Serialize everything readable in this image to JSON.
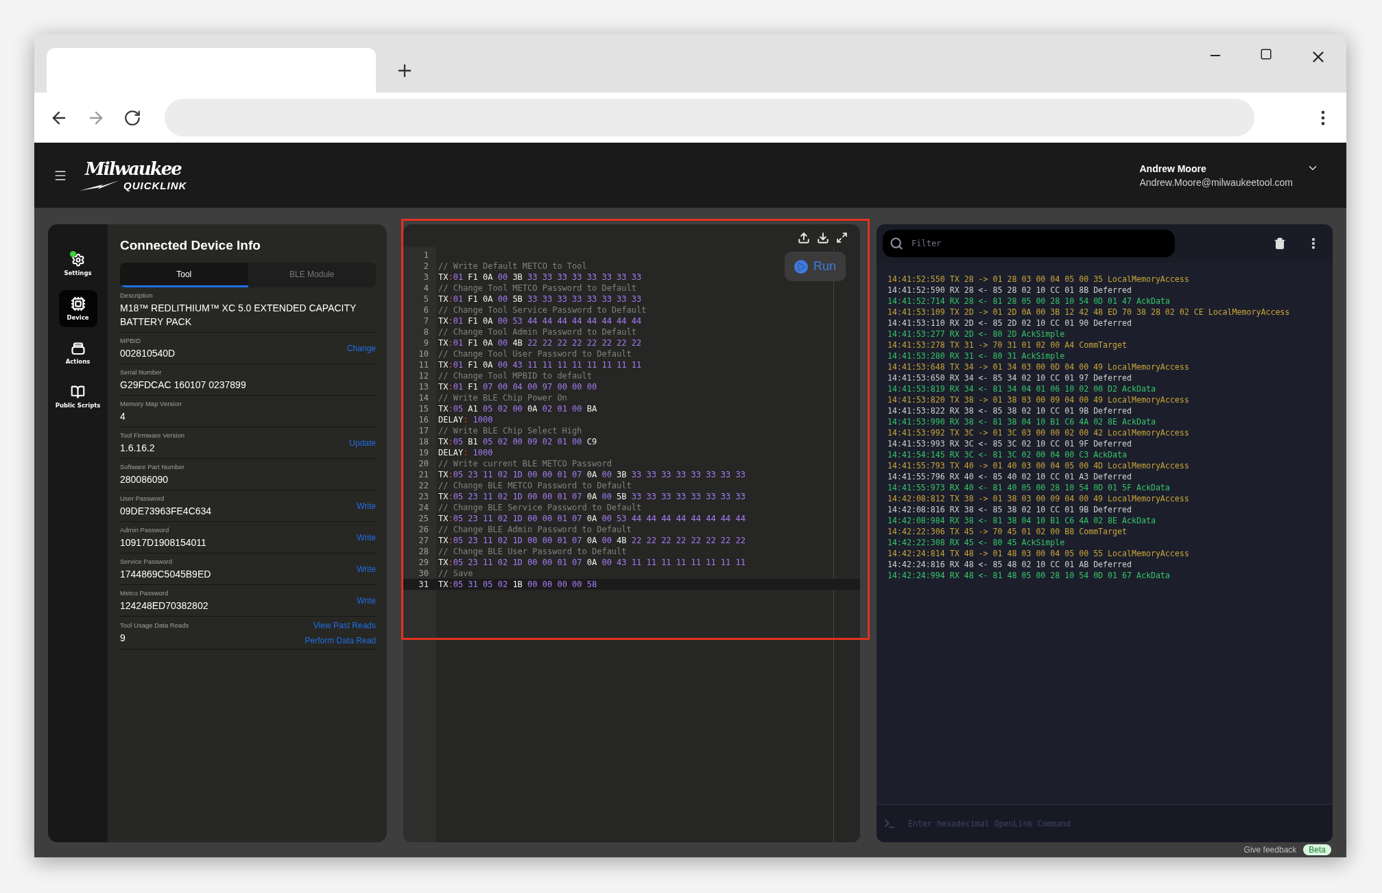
{
  "app_header": {
    "brand": "Milwaukee",
    "product": "QUICKLINK",
    "user_name": "Andrew Moore",
    "user_email": "Andrew.Moore@milwaukeetool.com"
  },
  "nav": [
    {
      "kind": "settings",
      "label": "Settings",
      "selected": false,
      "status_dot": true
    },
    {
      "kind": "device",
      "label": "Device",
      "selected": true,
      "status_dot": false
    },
    {
      "kind": "actions",
      "label": "Actions",
      "selected": false,
      "status_dot": false
    },
    {
      "kind": "scripts",
      "label": "Public Scripts",
      "selected": false,
      "status_dot": false
    }
  ],
  "device_info": {
    "title": "Connected Device Info",
    "tabs": [
      {
        "label": "Tool",
        "selected": true
      },
      {
        "label": "BLE Module",
        "selected": false
      }
    ],
    "fields": [
      {
        "label": "Description",
        "value": "M18™ REDLITHIUM™ XC 5.0 EXTENDED CAPACITY BATTERY PACK"
      },
      {
        "label": "MPBID",
        "value": "002810540D",
        "actions": [
          "Change"
        ]
      },
      {
        "label": "Serial Number",
        "value": "G29FDCAC 160107 0237899"
      },
      {
        "label": "Memory Map Version",
        "value": "4"
      },
      {
        "label": "Tool Firmware Version",
        "value": "1.6.16.2",
        "actions": [
          "Update"
        ]
      },
      {
        "label": "Software Part Number",
        "value": "280086090"
      },
      {
        "label": "User Password",
        "value": "09DE73963FE4C634",
        "actions": [
          "Write"
        ]
      },
      {
        "label": "Admin Password",
        "value": "10917D1908154011",
        "actions": [
          "Write"
        ]
      },
      {
        "label": "Service Password",
        "value": "1744869C5045B9ED",
        "actions": [
          "Write"
        ]
      },
      {
        "label": "Metco Password",
        "value": "124248ED70382802",
        "actions": [
          "Write"
        ]
      },
      {
        "label": "Tool Usage Data Reads",
        "value": "9",
        "actions": [
          "View Past Reads",
          "Perform Data Read"
        ]
      }
    ]
  },
  "editor": {
    "highlighted": true,
    "run_label": "Run",
    "lines": [
      {
        "n": "1",
        "active": false
      },
      {
        "n": "2",
        "active": false,
        "segments": [
          {
            "kind": "comment",
            "text": "// Write Default METCO to Tool"
          }
        ]
      },
      {
        "n": "3",
        "active": false,
        "segments": [
          {
            "kind": "plain",
            "text": "TX"
          },
          {
            "kind": "punct",
            "text": ":"
          },
          {
            "kind": "num",
            "text": "01"
          },
          {
            "kind": "plain",
            "text": " F1 0A "
          },
          {
            "kind": "num",
            "text": "00"
          },
          {
            "kind": "plain",
            "text": " 3B "
          },
          {
            "kind": "num",
            "text": "33 33 33 33 33 33 33 33"
          }
        ]
      },
      {
        "n": "4",
        "active": false,
        "segments": [
          {
            "kind": "comment",
            "text": "// Change Tool METCO Password to Default"
          }
        ]
      },
      {
        "n": "5",
        "active": false,
        "segments": [
          {
            "kind": "plain",
            "text": "TX"
          },
          {
            "kind": "punct",
            "text": ":"
          },
          {
            "kind": "num",
            "text": "01"
          },
          {
            "kind": "plain",
            "text": " F1 0A "
          },
          {
            "kind": "num",
            "text": "00"
          },
          {
            "kind": "plain",
            "text": " 5B "
          },
          {
            "kind": "num",
            "text": "33 33 33 33 33 33 33 33"
          }
        ]
      },
      {
        "n": "6",
        "active": false,
        "segments": [
          {
            "kind": "comment",
            "text": "// Change Tool Service Password to Default"
          }
        ]
      },
      {
        "n": "7",
        "active": false,
        "segments": [
          {
            "kind": "plain",
            "text": "TX"
          },
          {
            "kind": "punct",
            "text": ":"
          },
          {
            "kind": "num",
            "text": "01"
          },
          {
            "kind": "plain",
            "text": " F1 0A "
          },
          {
            "kind": "num",
            "text": "00 53 44 44 44 44 44 44 44 44"
          }
        ]
      },
      {
        "n": "8",
        "active": false,
        "segments": [
          {
            "kind": "comment",
            "text": "// Change Tool Admin Password to Default"
          }
        ]
      },
      {
        "n": "9",
        "active": false,
        "segments": [
          {
            "kind": "plain",
            "text": "TX"
          },
          {
            "kind": "punct",
            "text": ":"
          },
          {
            "kind": "num",
            "text": "01"
          },
          {
            "kind": "plain",
            "text": " F1 0A "
          },
          {
            "kind": "num",
            "text": "00"
          },
          {
            "kind": "plain",
            "text": " 4B "
          },
          {
            "kind": "num",
            "text": "22 22 22 22 22 22 22 22"
          }
        ]
      },
      {
        "n": "10",
        "active": false,
        "segments": [
          {
            "kind": "comment",
            "text": "// Change Tool User Password to Default"
          }
        ]
      },
      {
        "n": "11",
        "active": false,
        "segments": [
          {
            "kind": "plain",
            "text": "TX"
          },
          {
            "kind": "punct",
            "text": ":"
          },
          {
            "kind": "num",
            "text": "01"
          },
          {
            "kind": "plain",
            "text": " F1 0A "
          },
          {
            "kind": "num",
            "text": "00 43 11 11 11 11 11 11 11 11"
          }
        ]
      },
      {
        "n": "12",
        "active": false,
        "segments": [
          {
            "kind": "comment",
            "text": "// Change Tool MPBID to default"
          }
        ]
      },
      {
        "n": "13",
        "active": false,
        "segments": [
          {
            "kind": "plain",
            "text": "TX"
          },
          {
            "kind": "punct",
            "text": ":"
          },
          {
            "kind": "num",
            "text": "01"
          },
          {
            "kind": "plain",
            "text": " F1 "
          },
          {
            "kind": "num",
            "text": "07 00 04 00 97 00 00 00"
          }
        ]
      },
      {
        "n": "14",
        "active": false,
        "segments": [
          {
            "kind": "comment",
            "text": "// Write BLE Chip Power On"
          }
        ]
      },
      {
        "n": "15",
        "active": false,
        "segments": [
          {
            "kind": "plain",
            "text": "TX"
          },
          {
            "kind": "punct",
            "text": ":"
          },
          {
            "kind": "num",
            "text": "05"
          },
          {
            "kind": "plain",
            "text": " A1 "
          },
          {
            "kind": "num",
            "text": "05 02 00"
          },
          {
            "kind": "plain",
            "text": " 0A "
          },
          {
            "kind": "num",
            "text": "02 01 00"
          },
          {
            "kind": "plain",
            "text": " BA"
          }
        ]
      },
      {
        "n": "16",
        "active": false,
        "segments": [
          {
            "kind": "plain",
            "text": "DELAY"
          },
          {
            "kind": "punct",
            "text": ":"
          },
          {
            "kind": "num",
            "text": " 1000"
          }
        ]
      },
      {
        "n": "17",
        "active": false,
        "segments": [
          {
            "kind": "comment",
            "text": "// Write BLE Chip Select High"
          }
        ]
      },
      {
        "n": "18",
        "active": false,
        "segments": [
          {
            "kind": "plain",
            "text": "TX"
          },
          {
            "kind": "punct",
            "text": ":"
          },
          {
            "kind": "num",
            "text": "05"
          },
          {
            "kind": "plain",
            "text": " B1 "
          },
          {
            "kind": "num",
            "text": "05 02 00 09 02 01 00"
          },
          {
            "kind": "plain",
            "text": " C9"
          }
        ]
      },
      {
        "n": "19",
        "active": false,
        "segments": [
          {
            "kind": "plain",
            "text": "DELAY"
          },
          {
            "kind": "punct",
            "text": ":"
          },
          {
            "kind": "num",
            "text": " 1000"
          }
        ]
      },
      {
        "n": "20",
        "active": false,
        "segments": [
          {
            "kind": "comment",
            "text": "// Write current BLE METCO Password"
          }
        ]
      },
      {
        "n": "21",
        "active": false,
        "segments": [
          {
            "kind": "plain",
            "text": "TX"
          },
          {
            "kind": "punct",
            "text": ":"
          },
          {
            "kind": "num",
            "text": "05 23 11 02 1D 00 00 01 07"
          },
          {
            "kind": "plain",
            "text": " 0A "
          },
          {
            "kind": "num",
            "text": "00"
          },
          {
            "kind": "plain",
            "text": " 3B "
          },
          {
            "kind": "num",
            "text": "33 33 33 33 33 33 33 33"
          }
        ]
      },
      {
        "n": "22",
        "active": false,
        "segments": [
          {
            "kind": "comment",
            "text": "// Change BLE METCO Password to Default"
          }
        ]
      },
      {
        "n": "23",
        "active": false,
        "segments": [
          {
            "kind": "plain",
            "text": "TX"
          },
          {
            "kind": "punct",
            "text": ":"
          },
          {
            "kind": "num",
            "text": "05 23 11 02 1D 00 00 01 07"
          },
          {
            "kind": "plain",
            "text": " 0A "
          },
          {
            "kind": "num",
            "text": "00"
          },
          {
            "kind": "plain",
            "text": " 5B "
          },
          {
            "kind": "num",
            "text": "33 33 33 33 33 33 33 33"
          }
        ]
      },
      {
        "n": "24",
        "active": false,
        "segments": [
          {
            "kind": "comment",
            "text": "// Change BLE Service Password to Default"
          }
        ]
      },
      {
        "n": "25",
        "active": false,
        "segments": [
          {
            "kind": "plain",
            "text": "TX"
          },
          {
            "kind": "punct",
            "text": ":"
          },
          {
            "kind": "num",
            "text": "05 23 11 02 1D 00 00 01 07"
          },
          {
            "kind": "plain",
            "text": " 0A "
          },
          {
            "kind": "num",
            "text": "00 53 44 44 44 44 44 44 44 44"
          }
        ]
      },
      {
        "n": "26",
        "active": false,
        "segments": [
          {
            "kind": "comment",
            "text": "// Change BLE Admin Password to Default"
          }
        ]
      },
      {
        "n": "27",
        "active": false,
        "segments": [
          {
            "kind": "plain",
            "text": "TX"
          },
          {
            "kind": "punct",
            "text": ":"
          },
          {
            "kind": "num",
            "text": "05 23 11 02 1D 00 00 01 07"
          },
          {
            "kind": "plain",
            "text": " 0A "
          },
          {
            "kind": "num",
            "text": "00"
          },
          {
            "kind": "plain",
            "text": " 4B "
          },
          {
            "kind": "num",
            "text": "22 22 22 22 22 22 22 22"
          }
        ]
      },
      {
        "n": "28",
        "active": false,
        "segments": [
          {
            "kind": "comment",
            "text": "// Change BLE User Password to Default"
          }
        ]
      },
      {
        "n": "29",
        "active": false,
        "segments": [
          {
            "kind": "plain",
            "text": "TX"
          },
          {
            "kind": "punct",
            "text": ":"
          },
          {
            "kind": "num",
            "text": "05 23 11 02 1D 00 00 01 07"
          },
          {
            "kind": "plain",
            "text": " 0A "
          },
          {
            "kind": "num",
            "text": "00 43 11 11 11 11 11 11 11 11"
          }
        ]
      },
      {
        "n": "30",
        "active": false,
        "segments": [
          {
            "kind": "comment",
            "text": "// Save"
          }
        ]
      },
      {
        "n": "31",
        "active": true,
        "segments": [
          {
            "kind": "plain",
            "text": "TX"
          },
          {
            "kind": "punct",
            "text": ":"
          },
          {
            "kind": "num",
            "text": "05 31 05 02"
          },
          {
            "kind": "plain",
            "text": " 1B "
          },
          {
            "kind": "num",
            "text": "00 00 00 00 58"
          }
        ]
      }
    ]
  },
  "console": {
    "filter_placeholder": "Filter",
    "command_placeholder": "Enter hexadecimal OpenLink Command",
    "entries": [
      {
        "text": "14:41:52:550 TX 28 -> 01 28 03 00 04 05 00 35 LocalMemoryAccess",
        "color": "#c9a43a"
      },
      {
        "text": "14:41:52:590 RX 28 <- 85 28 02 10 CC 01 8B Deferred",
        "color": "#d0d0d0"
      },
      {
        "text": "14:41:52:714 RX 28 <- 81 28 05 00 28 10 54 0D 01 47 AckData",
        "color": "#35c46a"
      },
      {
        "text": "14:41:53:109 TX 2D -> 01 2D 0A 00 3B 12 42 48 ED 70 38 28 02 02 CE LocalMemoryAccess",
        "color": "#c9a43a"
      },
      {
        "text": "14:41:53:110 RX 2D <- 85 2D 02 10 CC 01 90 Deferred",
        "color": "#d0d0d0"
      },
      {
        "text": "14:41:53:277 RX 2D <- 80 2D AckSimple",
        "color": "#35c46a"
      },
      {
        "text": "14:41:53:278 TX 31 -> 70 31 01 02 00 A4 CommTarget",
        "color": "#c9a43a"
      },
      {
        "text": "14:41:53:280 RX 31 <- 80 31 AckSimple",
        "color": "#35c46a"
      },
      {
        "text": "14:41:53:648 TX 34 -> 01 34 03 00 0D 04 00 49 LocalMemoryAccess",
        "color": "#c9a43a"
      },
      {
        "text": "14:41:53:650 RX 34 <- 85 34 02 10 CC 01 97 Deferred",
        "color": "#d0d0d0"
      },
      {
        "text": "14:41:53:819 RX 34 <- 81 34 04 01 06 10 02 00 D2 AckData",
        "color": "#35c46a"
      },
      {
        "text": "14:41:53:820 TX 38 -> 01 38 03 00 09 04 00 49 LocalMemoryAccess",
        "color": "#c9a43a"
      },
      {
        "text": "14:41:53:822 RX 38 <- 85 38 02 10 CC 01 9B Deferred",
        "color": "#d0d0d0"
      },
      {
        "text": "14:41:53:990 RX 38 <- 81 38 04 10 B1 C6 4A 02 8E AckData",
        "color": "#35c46a"
      },
      {
        "text": "14:41:53:992 TX 3C -> 01 3C 03 00 00 02 00 42 LocalMemoryAccess",
        "color": "#c9a43a"
      },
      {
        "text": "14:41:53:993 RX 3C <- 85 3C 02 10 CC 01 9F Deferred",
        "color": "#d0d0d0"
      },
      {
        "text": "14:41:54:145 RX 3C <- 81 3C 02 00 04 00 C3 AckData",
        "color": "#35c46a"
      },
      {
        "text": "14:41:55:793 TX 40 -> 01 40 03 00 04 05 00 4D LocalMemoryAccess",
        "color": "#c9a43a"
      },
      {
        "text": "14:41:55:796 RX 40 <- 85 40 02 10 CC 01 A3 Deferred",
        "color": "#d0d0d0"
      },
      {
        "text": "14:41:55:973 RX 40 <- 81 40 05 00 28 10 54 0D 01 5F AckData",
        "color": "#35c46a"
      },
      {
        "text": "14:42:08:812 TX 38 -> 01 38 03 00 09 04 00 49 LocalMemoryAccess",
        "color": "#c9a43a"
      },
      {
        "text": "14:42:08:816 RX 38 <- 85 38 02 10 CC 01 9B Deferred",
        "color": "#d0d0d0"
      },
      {
        "text": "14:42:08:984 RX 38 <- 81 38 04 10 B1 C6 4A 02 8E AckData",
        "color": "#35c46a"
      },
      {
        "text": "14:42:22:306 TX 45 -> 70 45 01 02 00 B8 CommTarget",
        "color": "#c9a43a"
      },
      {
        "text": "14:42:22:308 RX 45 <- 80 45 AckSimple",
        "color": "#35c46a"
      },
      {
        "text": "14:42:24:814 TX 48 -> 01 48 03 00 04 05 00 55 LocalMemoryAccess",
        "color": "#c9a43a"
      },
      {
        "text": "14:42:24:816 RX 48 <- 85 48 02 10 CC 01 AB Deferred",
        "color": "#d0d0d0"
      },
      {
        "text": "14:42:24:994 RX 48 <- 81 48 05 00 28 10 54 0D 01 67 AckData",
        "color": "#35c46a"
      }
    ]
  },
  "footer": {
    "feedback": "Give feedback",
    "badge": "Beta"
  }
}
